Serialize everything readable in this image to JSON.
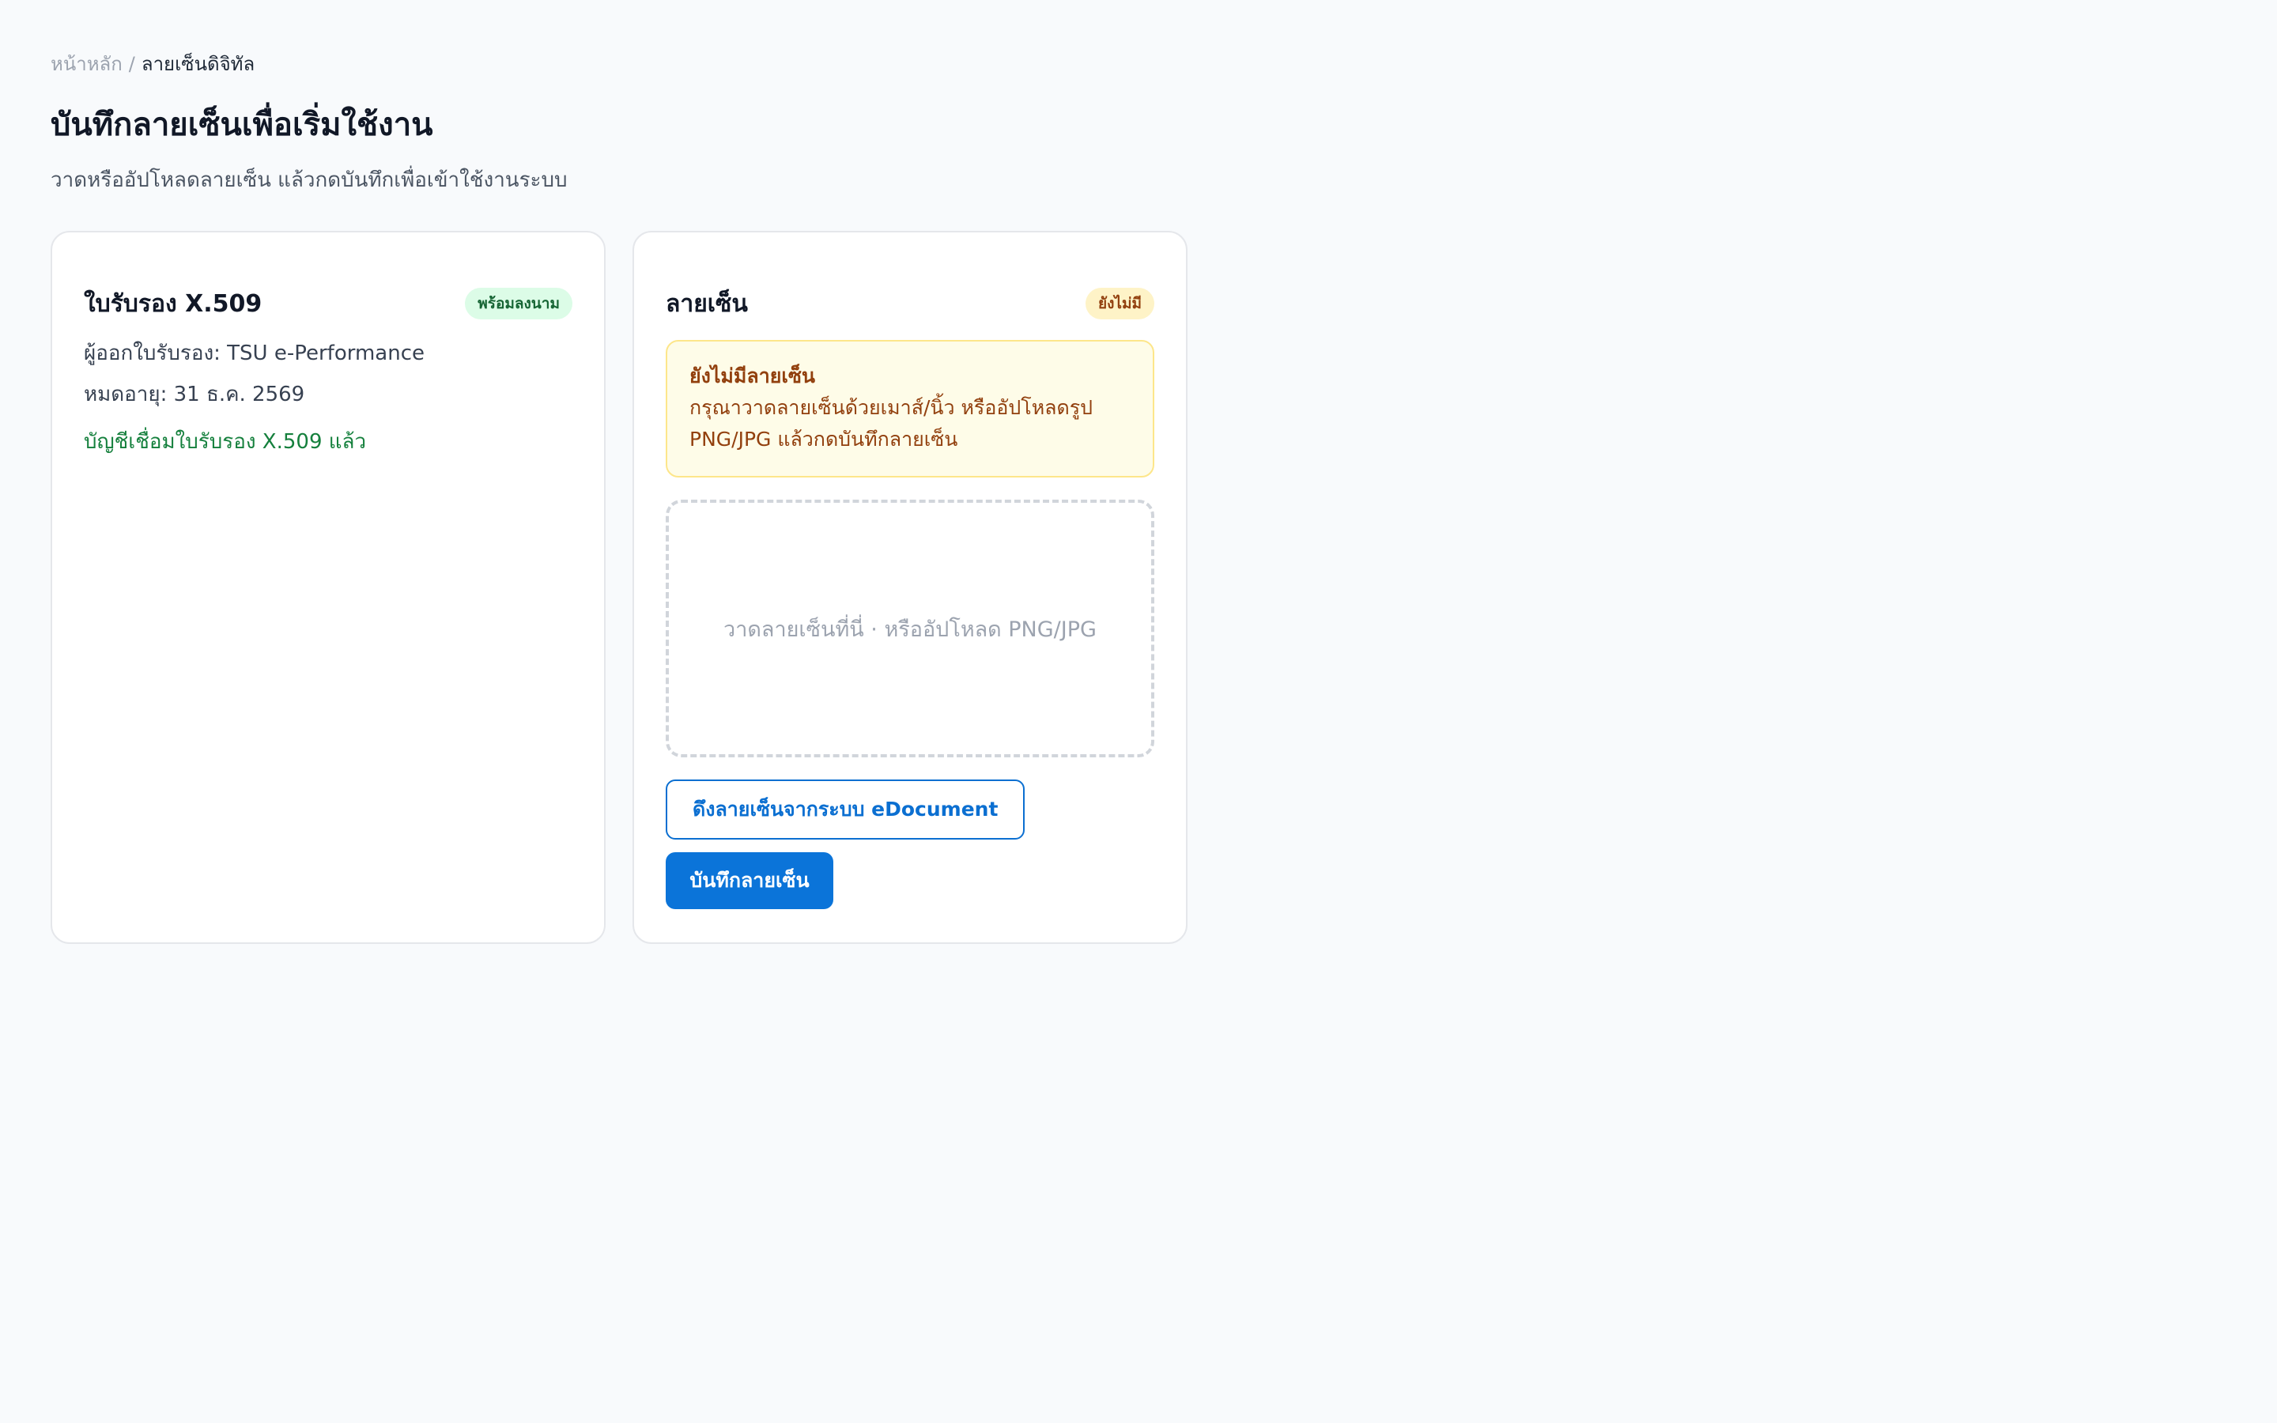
{
  "breadcrumb": {
    "home": "หน้าหลัก",
    "separator": "/",
    "current": "ลายเซ็นดิจิทัล"
  },
  "page": {
    "title": "บันทึกลายเซ็นเพื่อเริ่มใช้งาน",
    "subtitle": "วาดหรืออัปโหลดลายเซ็น แล้วกดบันทึกเพื่อเข้าใช้งานระบบ"
  },
  "certificate_card": {
    "title": "ใบรับรอง X.509",
    "badge": "พร้อมลงนาม",
    "issuer": "ผู้ออกใบรับรอง: TSU e-Performance",
    "expiry": "หมดอายุ: 31 ธ.ค. 2569",
    "linked_status": "บัญชีเชื่อมใบรับรอง X.509 แล้ว"
  },
  "signature_card": {
    "title": "ลายเซ็น",
    "badge": "ยังไม่มี",
    "alert_title": "ยังไม่มีลายเซ็น",
    "alert_body": "กรุณาวาดลายเซ็นด้วยเมาส์/นิ้ว หรืออัปโหลดรูป PNG/JPG แล้วกดบันทึกลายเซ็น",
    "dropzone_text": "วาดลายเซ็นที่นี่ · หรืออัปโหลด PNG/JPG",
    "fetch_button": "ดึงลายเซ็นจากระบบ eDocument",
    "save_button": "บันทึกลายเซ็น"
  },
  "colors": {
    "background": "#f8fafc",
    "primary": "#0b74d9",
    "success_text": "#15803d",
    "warning_text": "#92400e",
    "warning_bg": "#fefce8"
  }
}
